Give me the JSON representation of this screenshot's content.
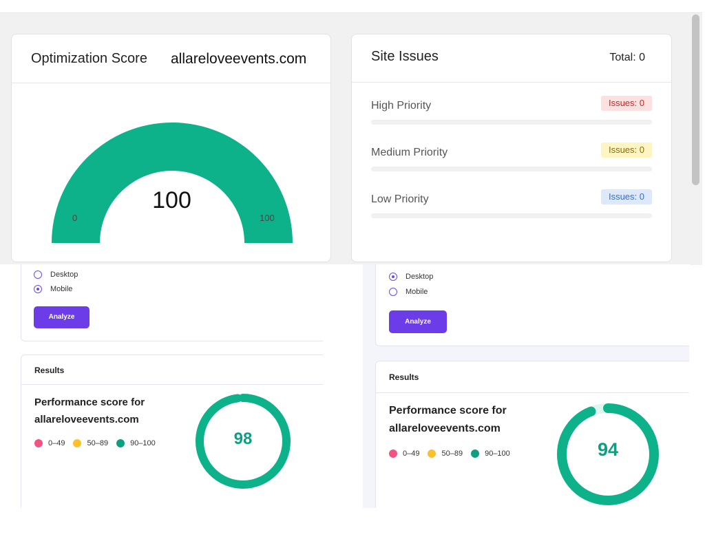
{
  "optimization": {
    "title": "Optimization Score",
    "domain": "allareloveevents.com",
    "score": "100",
    "score_value": 100,
    "min": "0",
    "max": "100",
    "gauge_color": "#0db28a"
  },
  "site_issues": {
    "title": "Site Issues",
    "total": "Total: 0",
    "rows": [
      {
        "label": "High Priority",
        "badge": "Issues: 0",
        "bg": "#fde0e0",
        "fg": "#c62828"
      },
      {
        "label": "Medium Priority",
        "badge": "Issues: 0",
        "bg": "#fff5c2",
        "fg": "#8a6d00"
      },
      {
        "label": "Low Priority",
        "badge": "Issues: 0",
        "bg": "#dde9fb",
        "fg": "#2f6fd6"
      }
    ]
  },
  "left_panel": {
    "options": [
      "Desktop",
      "Mobile"
    ],
    "selected": "Mobile",
    "analyze": "Analyze",
    "results_title": "Results",
    "perf_line1": "Performance score for",
    "perf_line2": "allareloveevents.com",
    "score": "98",
    "score_value": 98
  },
  "right_panel": {
    "options": [
      "Desktop",
      "Mobile"
    ],
    "selected": "Desktop",
    "analyze": "Analyze",
    "results_title": "Results",
    "perf_line1": "Performance score for",
    "perf_line2": "allareloveevents.com",
    "score": "94",
    "score_value": 94
  },
  "legend": [
    {
      "label": "0–49",
      "color": "#f25382"
    },
    {
      "label": "50–89",
      "color": "#fbc02d"
    },
    {
      "label": "90–100",
      "color": "#0e9f80"
    }
  ],
  "colors": {
    "accent": "#6b3ce8",
    "ring": "#0db28a",
    "ring_track": "#dff5ef"
  }
}
